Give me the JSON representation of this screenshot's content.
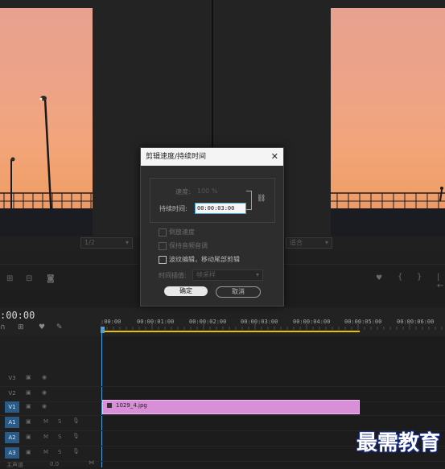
{
  "dialog": {
    "title": "剪辑速度/持续时间",
    "close_glyph": "✕",
    "speed_label": "速度:",
    "speed_value": "100 %",
    "duration_label": "持续时间:",
    "duration_value": "00:00:03:00",
    "link_glyph": "⛓",
    "reverse_label": "倒放速度",
    "maintain_pitch_label": "保持音频音调",
    "ripple_label": "波纹编辑，移动尾部剪辑",
    "interp_label": "时间插值:",
    "interp_value": "帧采样",
    "ok_label": "确定",
    "cancel_label": "取消",
    "ripple_checked": false
  },
  "monitor": {
    "left_zoom": "1/2",
    "right_fit": "适合"
  },
  "timeline": {
    "timecode": ":00:00",
    "ruler_ticks": [
      ":00:00",
      "00:00:01:00",
      "00:00:02:00",
      "00:00:03:00",
      "00:00:04:00",
      "00:00:05:00",
      "00:00:06:00"
    ],
    "tracks": [
      {
        "name": "V3",
        "active": false
      },
      {
        "name": "V2",
        "active": false
      },
      {
        "name": "V1",
        "active": true
      },
      {
        "name": "A1",
        "active": true
      },
      {
        "name": "A2",
        "active": true
      },
      {
        "name": "A3",
        "active": true
      }
    ],
    "mute_label": "M",
    "solo_label": "S",
    "master_label": "主声道",
    "master_value": "0.0",
    "clip_name": "1029_4.jpg",
    "clip_color": "#d88fd8"
  },
  "watermark": "最需教育",
  "colors": {
    "accent_blue": "#2a5b86",
    "playhead": "#4aa3df",
    "work_area": "#e6c200"
  }
}
